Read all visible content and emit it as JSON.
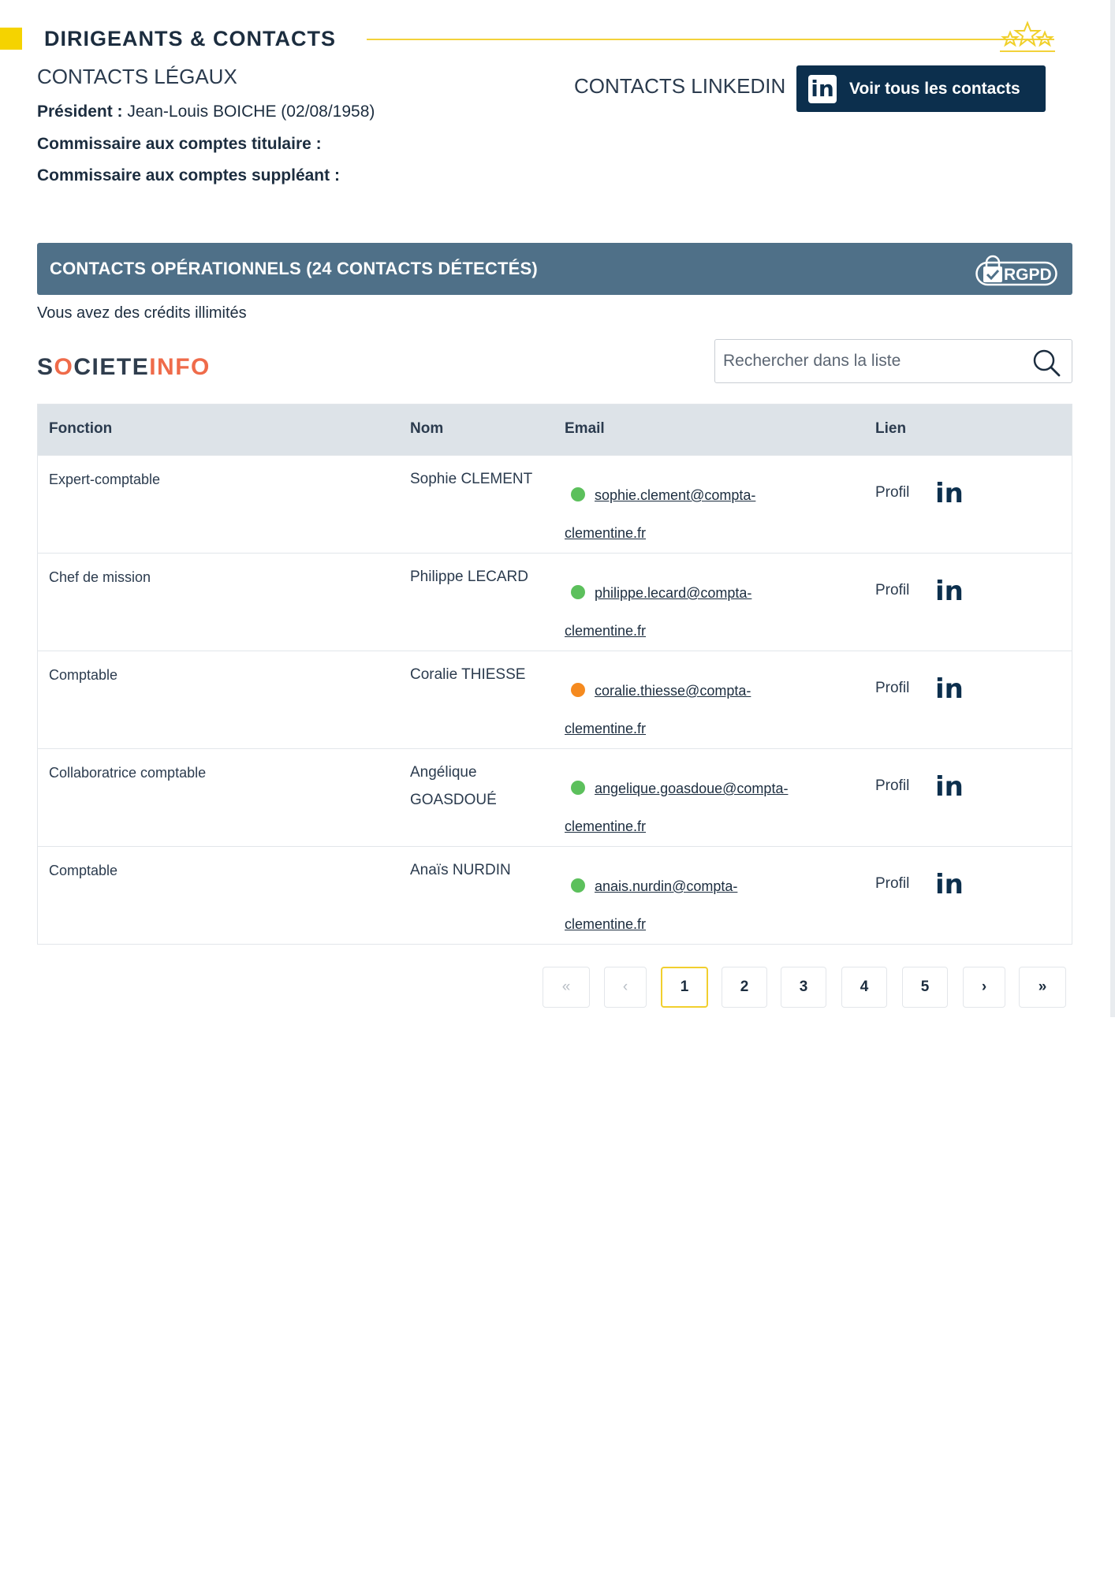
{
  "section": {
    "title": "DIRIGEANTS & CONTACTS",
    "accent_color": "#f5d300"
  },
  "legal": {
    "title": "CONTACTS LÉGAUX",
    "president_label": "Président :",
    "president_value": "Jean-Louis BOICHE (02/08/1958)",
    "auditor_titular_label": "Commissaire aux comptes titulaire :",
    "auditor_substitute_label": "Commissaire aux comptes suppléant :"
  },
  "linkedin": {
    "title": "CONTACTS LINKEDIN",
    "logo_text": "in",
    "button_label": "Voir tous les contacts",
    "button_color": "#0c2f4d"
  },
  "operational": {
    "title": "CONTACTS OPÉRATIONNELS (24 CONTACTS DÉTECTÉS)",
    "badge": "RGPD",
    "band_color": "#4f7088",
    "credits_text": "Vous avez des crédits illimités"
  },
  "brand": {
    "part1": "S",
    "o1": "O",
    "part2": "CIETE",
    "part3": "INF",
    "o2": "O",
    "accent_color": "#ef6b4a"
  },
  "search": {
    "placeholder": "Rechercher dans la liste",
    "icon": "search-icon"
  },
  "table": {
    "headers": {
      "fonction": "Fonction",
      "nom": "Nom",
      "email": "Email",
      "lien": "Lien"
    },
    "rows": [
      {
        "fonction": "Expert-comptable",
        "nom": "Sophie CLEMENT",
        "email_line1": "sophie.clement@compta-",
        "email_line2": "clementine.fr",
        "status_color": "#5cc05c",
        "profil": "Profil",
        "li": "in"
      },
      {
        "fonction": "Chef de mission",
        "nom": "Philippe LECARD",
        "email_line1": "philippe.lecard@compta-",
        "email_line2": "clementine.fr",
        "status_color": "#5cc05c",
        "profil": "Profil",
        "li": "in"
      },
      {
        "fonction": "Comptable",
        "nom": "Coralie THIESSE",
        "email_line1": "coralie.thiesse@compta-",
        "email_line2": "clementine.fr",
        "status_color": "#f58a1f",
        "profil": "Profil",
        "li": "in"
      },
      {
        "fonction": "Collaboratrice comptable",
        "nom": "Angélique GOASDOUÉ",
        "email_line1": "angelique.goasdoue@compta-",
        "email_line2": "clementine.fr",
        "status_color": "#5cc05c",
        "profil": "Profil",
        "li": "in"
      },
      {
        "fonction": "Comptable",
        "nom": "Anaïs NURDIN",
        "email_line1": "anais.nurdin@compta-",
        "email_line2": "clementine.fr",
        "status_color": "#5cc05c",
        "profil": "Profil",
        "li": "in"
      }
    ]
  },
  "pagination": {
    "first": "«",
    "prev": "‹",
    "pages": [
      "1",
      "2",
      "3",
      "4",
      "5"
    ],
    "current": "1",
    "next": "›",
    "last": "»",
    "active_color": "#f1cf2e"
  }
}
